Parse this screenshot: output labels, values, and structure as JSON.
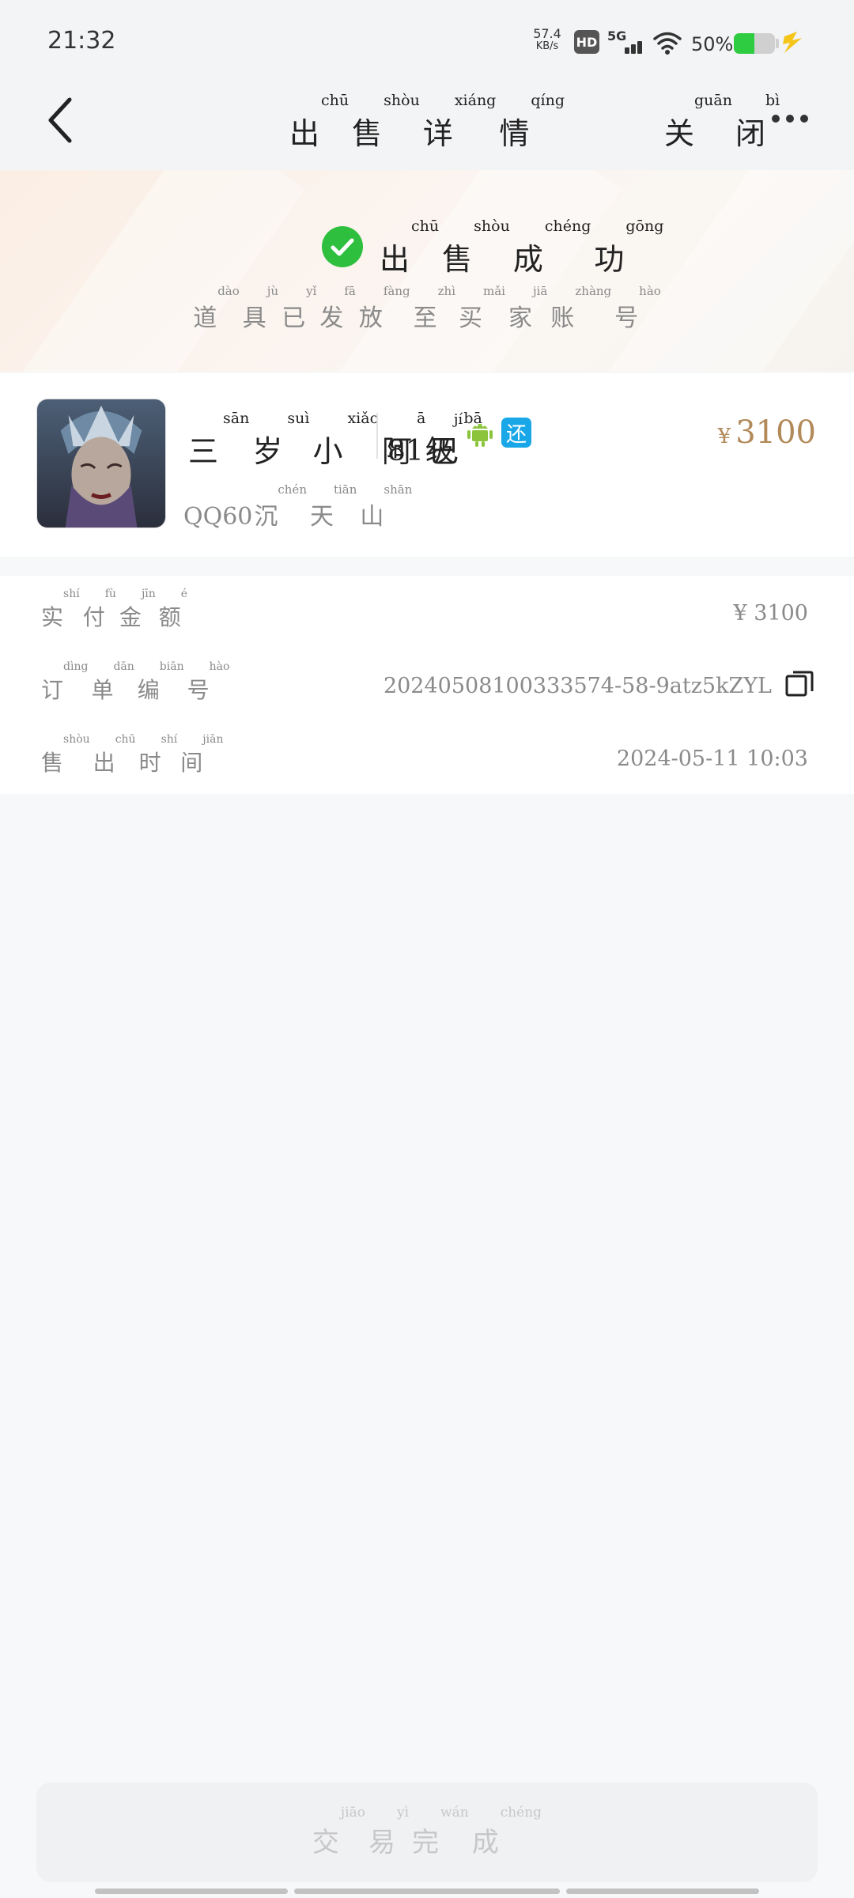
{
  "status_bar": {
    "time": "21:32",
    "net_speed_value": "57.4",
    "net_speed_unit": "KB/s",
    "hd_label": "HD",
    "network_label": "5G",
    "battery_percent": "50%",
    "battery_level": 0.5,
    "battery_color": "#2ecc40"
  },
  "nav": {
    "title": [
      {
        "char": "出",
        "pinyin": "chū"
      },
      {
        "char": "售",
        "pinyin": "shòu"
      },
      {
        "char": "详",
        "pinyin": "xiáng"
      },
      {
        "char": "情",
        "pinyin": "qíng"
      }
    ],
    "close": [
      {
        "char": "关",
        "pinyin": "guān"
      },
      {
        "char": "闭",
        "pinyin": "bì"
      }
    ],
    "back_icon": "chevron-left-icon",
    "more_icon": "more-dots-icon"
  },
  "banner": {
    "status_icon": "check-circle-icon",
    "status_color": "#2fbf3f",
    "title": [
      {
        "char": "出",
        "pinyin": "chū"
      },
      {
        "char": "售",
        "pinyin": "shòu"
      },
      {
        "char": "成",
        "pinyin": "chéng"
      },
      {
        "char": "功",
        "pinyin": "gōng"
      }
    ],
    "subtitle": [
      {
        "char": "道",
        "pinyin": "dào"
      },
      {
        "char": "具",
        "pinyin": "jù"
      },
      {
        "char": "已",
        "pinyin": "yǐ"
      },
      {
        "char": "发",
        "pinyin": "fā"
      },
      {
        "char": "放",
        "pinyin": "fàng"
      },
      {
        "char": "至",
        "pinyin": "zhì"
      },
      {
        "char": "买",
        "pinyin": "mǎi"
      },
      {
        "char": "家",
        "pinyin": "jiā"
      },
      {
        "char": "账",
        "pinyin": "zhàng"
      },
      {
        "char": "号",
        "pinyin": "hào"
      }
    ]
  },
  "account": {
    "name": [
      {
        "char": "三",
        "pinyin": "sān"
      },
      {
        "char": "岁",
        "pinyin": "suì"
      },
      {
        "char": "小",
        "pinyin": "xiǎo"
      },
      {
        "char": "阿",
        "pinyin": "ā"
      },
      {
        "char": "巴",
        "pinyin": "bā"
      }
    ],
    "level_number": "81",
    "level_unit": [
      {
        "char": "级",
        "pinyin": "jí"
      }
    ],
    "platform_icon": "android-icon",
    "return_badge": "还",
    "currency": "¥",
    "price": "3100",
    "server_prefix": "QQ60",
    "server_name": [
      {
        "char": "沉",
        "pinyin": "chén"
      },
      {
        "char": "天",
        "pinyin": "tiān"
      },
      {
        "char": "山",
        "pinyin": "shān"
      }
    ],
    "price_color": "#b28a5a"
  },
  "details": [
    {
      "label": [
        {
          "char": "实",
          "pinyin": "shí"
        },
        {
          "char": "付",
          "pinyin": "fù"
        },
        {
          "char": "金",
          "pinyin": "jīn"
        },
        {
          "char": "额",
          "pinyin": "é"
        }
      ],
      "value": "¥ 3100"
    },
    {
      "label": [
        {
          "char": "订",
          "pinyin": "dìng"
        },
        {
          "char": "单",
          "pinyin": "dān"
        },
        {
          "char": "编",
          "pinyin": "biān"
        },
        {
          "char": "号",
          "pinyin": "hào"
        }
      ],
      "value": "20240508100333574-58-9atz5kZYL",
      "action_icon": "copy-icon"
    },
    {
      "label": [
        {
          "char": "售",
          "pinyin": "shòu"
        },
        {
          "char": "出",
          "pinyin": "chū"
        },
        {
          "char": "时",
          "pinyin": "shí"
        },
        {
          "char": "间",
          "pinyin": "jiān"
        }
      ],
      "value": "2024-05-11 10:03"
    }
  ],
  "bottom_button": [
    {
      "char": "交",
      "pinyin": "jiāo"
    },
    {
      "char": "易",
      "pinyin": "yì"
    },
    {
      "char": "完",
      "pinyin": "wán"
    },
    {
      "char": "成",
      "pinyin": "chéng"
    }
  ]
}
